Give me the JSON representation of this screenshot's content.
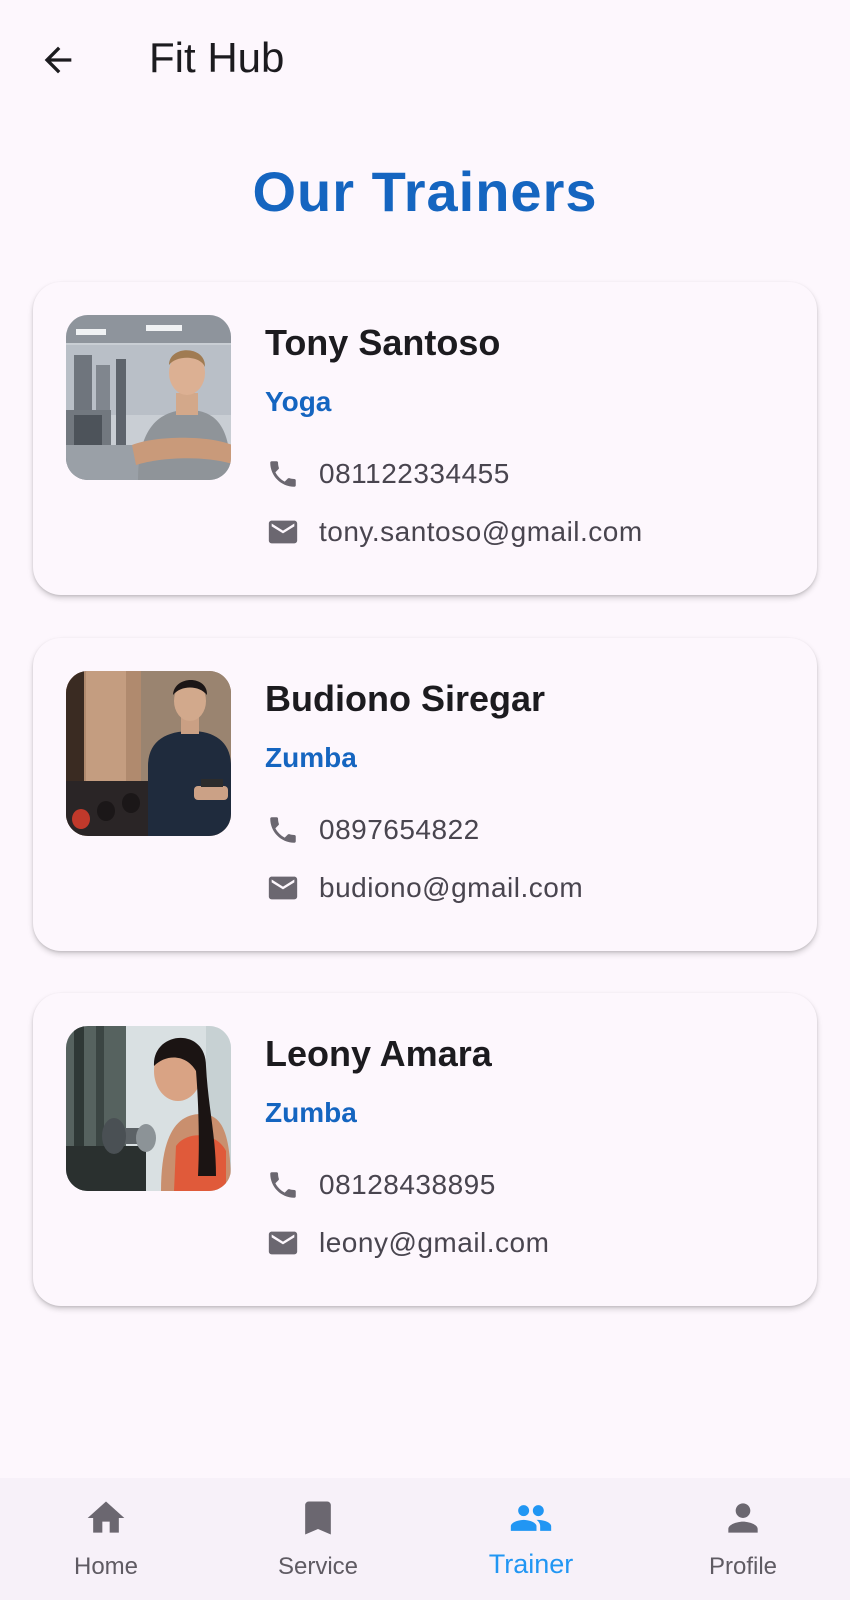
{
  "app_bar": {
    "title": "Fit Hub",
    "back_icon": "arrow-back-icon"
  },
  "heading": "Our Trainers",
  "trainers": [
    {
      "name": "Tony Santoso",
      "specialty": "Yoga",
      "phone": "081122334455",
      "email": "tony.santoso@gmail.com"
    },
    {
      "name": "Budiono Siregar",
      "specialty": "Zumba",
      "phone": "0897654822",
      "email": "budiono@gmail.com"
    },
    {
      "name": "Leony Amara",
      "specialty": "Zumba",
      "phone": "08128438895",
      "email": "leony@gmail.com"
    }
  ],
  "bottom_nav": {
    "items": [
      {
        "label": "Home",
        "icon": "home-icon"
      },
      {
        "label": "Service",
        "icon": "bookmark-icon"
      },
      {
        "label": "Trainer",
        "icon": "people-icon",
        "active": true
      },
      {
        "label": "Profile",
        "icon": "person-icon"
      }
    ]
  },
  "colors": {
    "accent": "#1565c0",
    "nav_active": "#2196f3",
    "background": "#fdf7fd"
  }
}
